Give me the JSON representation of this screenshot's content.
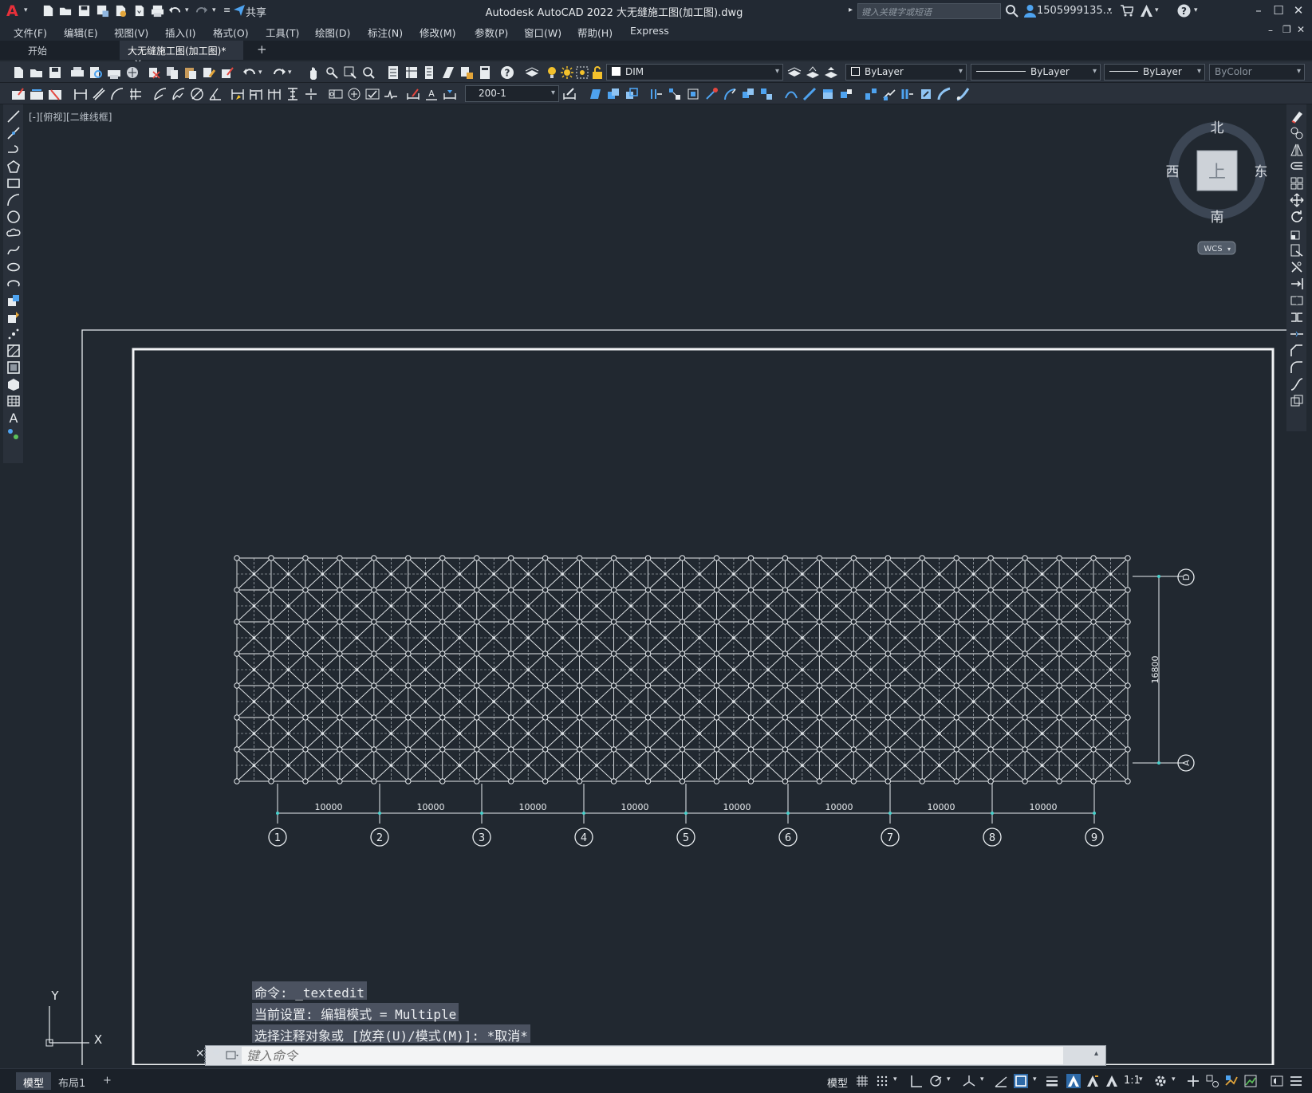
{
  "titlebar": {
    "app_title": "Autodesk AutoCAD 2022    大无缝施工图(加工图).dwg",
    "share_label": "共享",
    "search_placeholder": "键入关键字或短语",
    "user_name": "1505999135...",
    "logo_letter": "A"
  },
  "menubar": {
    "items": [
      "文件(F)",
      "编辑(E)",
      "视图(V)",
      "插入(I)",
      "格式(O)",
      "工具(T)",
      "绘图(D)",
      "标注(N)",
      "修改(M)",
      "参数(P)",
      "窗口(W)",
      "帮助(H)",
      "Express"
    ]
  },
  "tabs": {
    "start": "开始",
    "document": "大无缝施工图(加工图)*",
    "close_glyph": "✕",
    "add_glyph": "+"
  },
  "toolbar": {
    "layer_combo": "DIM",
    "color_combo": "ByLayer",
    "linetype_combo": "ByLayer",
    "lineweight_combo": "ByLayer",
    "plotstyle_combo": "ByColor",
    "dimstyle_combo": "200-1"
  },
  "viewport": {
    "label": "[-][俯视][二维线框]"
  },
  "viewcube": {
    "north": "北",
    "south": "南",
    "east": "东",
    "west": "西",
    "top_face": "上",
    "ucs": "WCS"
  },
  "drawing": {
    "dimension_labels": [
      "10000",
      "10000",
      "10000",
      "10000",
      "10000",
      "10000",
      "10000",
      "10000"
    ],
    "vertical_dimension": "16800",
    "axis_numbers": [
      "1",
      "2",
      "3",
      "4",
      "5",
      "6",
      "7",
      "8",
      "9"
    ],
    "axis_letters": [
      "D",
      "A"
    ],
    "ucs_x": "X",
    "ucs_y": "Y"
  },
  "command": {
    "history": [
      "命令: _textedit",
      "当前设置: 编辑模式 = Multiple",
      "选择注释对象或 [放弃(U)/模式(M)]: *取消*"
    ],
    "placeholder": "键入命令"
  },
  "statusbar": {
    "model_tab": "模型",
    "layout_tab": "布局1",
    "add_tab": "+",
    "model_label": "模型",
    "scale": "1:1"
  }
}
